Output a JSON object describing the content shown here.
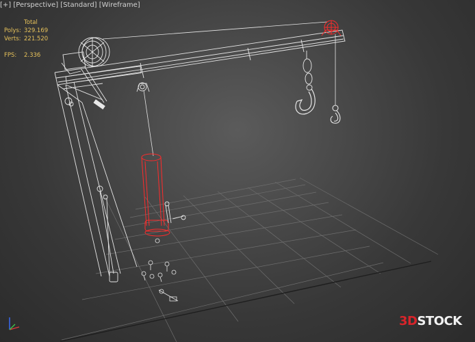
{
  "viewport": {
    "menu": {
      "plus": "[+]",
      "view": "[Perspective]",
      "shading": "[Standard]",
      "style": "[Wireframe]"
    },
    "stats": {
      "header": "Total",
      "polys_label": "Polys:",
      "polys_value": "329.169",
      "verts_label": "Verts:",
      "verts_value": "221.520",
      "fps_label": "FPS:",
      "fps_value": "2.336"
    }
  },
  "watermark": {
    "part1": "3D",
    "part2": "STOCK"
  },
  "axis_gizmo": {
    "labels": [
      "x",
      "y",
      "z"
    ]
  },
  "colors": {
    "background": "#3f3f3f",
    "grid": "#6a6a6a",
    "wireframe": "#e8e8e8",
    "selected": "#ff2b2b",
    "stats_text": "#e6c15a",
    "menu_text": "#d2d2d2"
  }
}
